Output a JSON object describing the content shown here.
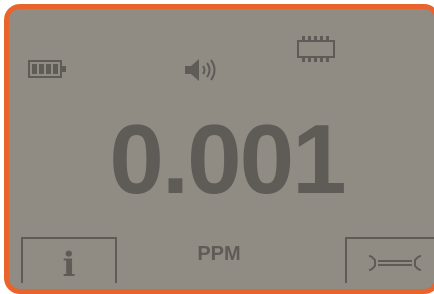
{
  "display": {
    "reading": "0.001",
    "unit": "PPM"
  },
  "status_icons": {
    "battery": "battery-full-icon",
    "sound": "speaker-on-icon",
    "memory": "memory-chip-icon"
  },
  "softkeys": {
    "left": {
      "label": "i",
      "icon": "info-icon"
    },
    "right": {
      "icon": "wrench-icon"
    }
  },
  "colors": {
    "bezel": "#e8642c",
    "lcd_background": "#908b83",
    "lcd_foreground": "#5f5c57"
  }
}
